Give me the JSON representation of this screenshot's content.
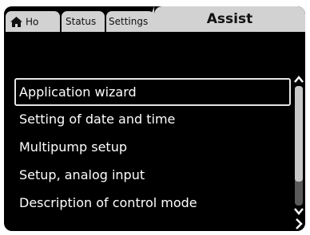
{
  "tabs": {
    "home": {
      "label": "Ho",
      "icon": "home-icon"
    },
    "status": {
      "label": "Status"
    },
    "settings": {
      "label": "Settings"
    },
    "assist": {
      "label": "Assist"
    }
  },
  "menu": {
    "items": [
      {
        "label": "Application wizard",
        "selected": true
      },
      {
        "label": "Setting of date and time"
      },
      {
        "label": "Multipump setup"
      },
      {
        "label": "Setup, analog input"
      },
      {
        "label": "Description of control mode"
      }
    ]
  },
  "scrollbar": {
    "position_fraction": 0.0
  },
  "colors": {
    "background": "#000000",
    "tab": "#d2d2d2",
    "text": "#ffffff"
  }
}
